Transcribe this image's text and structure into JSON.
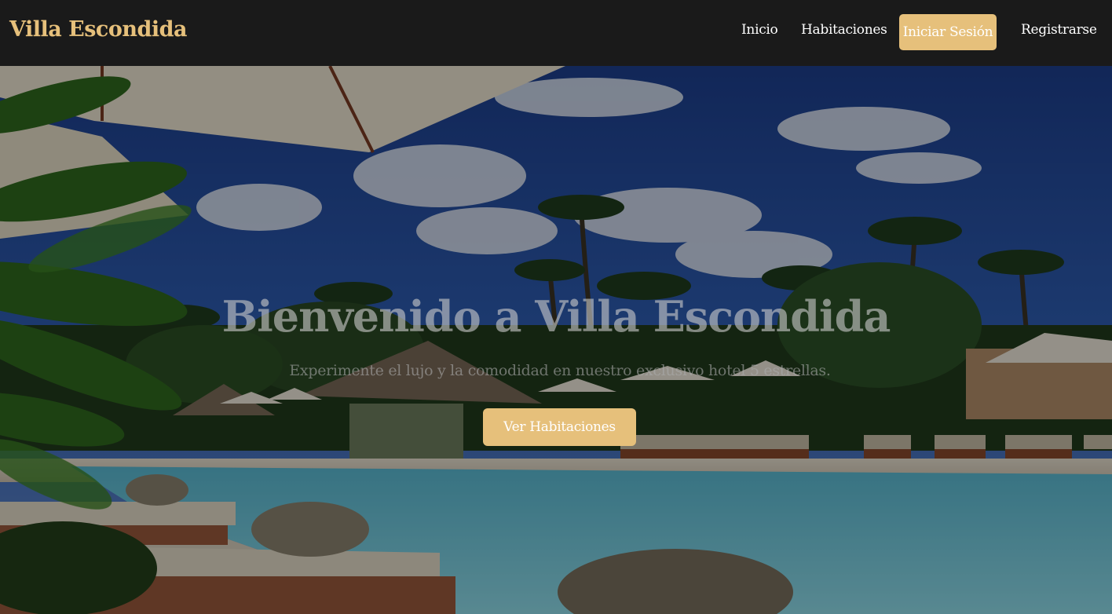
{
  "brand": {
    "name": "Villa Escondida",
    "color": "#e6c07b"
  },
  "nav": {
    "inicio": "Inicio",
    "habitaciones": "Habitaciones",
    "login": "Iniciar Sesión",
    "registrarse": "Registrarse"
  },
  "hero": {
    "title": "Bienvenido a Villa Escondida",
    "subtitle": "Experimente el lujo y la comodidad en nuestro exclusivo hotel 5 estrellas.",
    "cta": "Ver Habitaciones",
    "background": "resort-pool-palm-trees-image"
  },
  "colors": {
    "accent": "#e6c07b",
    "navbar": "#1a1a1a"
  }
}
